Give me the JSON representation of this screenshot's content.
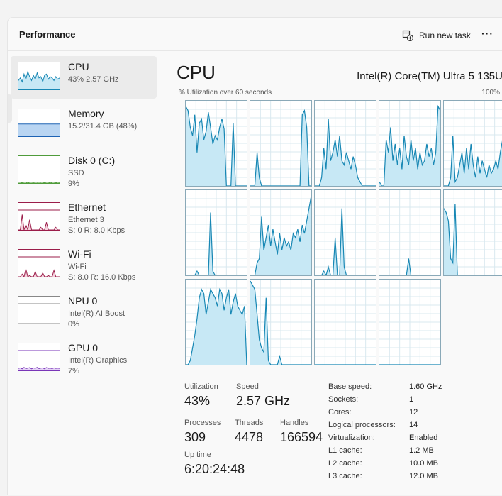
{
  "header": {
    "title": "Performance",
    "run_task_label": "Run new task",
    "more_label": "···"
  },
  "sidebar": {
    "items": [
      {
        "name": "CPU",
        "line1": "43% 2.57 GHz",
        "line2": "",
        "line3": "",
        "color": "#1787b4",
        "fill": "#c7e8f5",
        "selected": true
      },
      {
        "name": "Memory",
        "line1": "15.2/31.4 GB (48%)",
        "line2": "",
        "line3": "",
        "color": "#1e63b4",
        "fill": "#b9d5f2"
      },
      {
        "name": "Disk 0 (C:)",
        "line1": "SSD",
        "line2": "9%",
        "line3": "",
        "color": "#4f9b3a",
        "fill": "#d8efcd"
      },
      {
        "name": "Ethernet",
        "line1": "Ethernet 3",
        "line2": "S: 0 R: 8.0 Kbps",
        "line3": "",
        "color": "#9b1d4a",
        "fill": "#f4d2dd"
      },
      {
        "name": "Wi-Fi",
        "line1": "Wi-Fi",
        "line2": "S: 8.0 R: 16.0 Kbps",
        "line3": "",
        "color": "#9b1d4a",
        "fill": "#f4d2dd"
      },
      {
        "name": "NPU 0",
        "line1": "Intel(R) AI Boost",
        "line2": "0%",
        "line3": "",
        "color": "#888888",
        "fill": "#ffffff"
      },
      {
        "name": "GPU 0",
        "line1": "Intel(R) Graphics",
        "line2": "7%",
        "line3": "",
        "color": "#7a36b8",
        "fill": "#e4d3f5"
      }
    ]
  },
  "main": {
    "title": "CPU",
    "model": "Intel(R) Core(TM) Ultra 5 135U",
    "util_label": "% Utilization over 60 seconds",
    "util_max": "100%",
    "line_color": "#1787b4",
    "fill_color": "#c7e8f5",
    "grid_color": "#d9e8ef"
  },
  "chart_data": {
    "type": "area",
    "ylim": [
      0,
      100
    ],
    "series": [
      {
        "values": [
          95,
          90,
          70,
          60,
          85,
          40,
          75,
          80,
          55,
          65,
          88,
          70,
          50,
          60,
          55,
          70,
          80,
          68,
          0,
          0,
          0,
          75,
          0,
          0,
          0,
          0,
          0,
          0
        ]
      },
      {
        "values": [
          0,
          0,
          0,
          40,
          10,
          0,
          0,
          0,
          0,
          0,
          0,
          0,
          0,
          0,
          0,
          0,
          0,
          0,
          0,
          0,
          0,
          0,
          0,
          85,
          90,
          70,
          0,
          0
        ]
      },
      {
        "values": [
          0,
          0,
          0,
          10,
          45,
          20,
          80,
          30,
          40,
          55,
          35,
          60,
          30,
          25,
          40,
          30,
          20,
          35,
          25,
          10,
          5,
          0,
          0,
          0,
          0,
          0,
          0,
          0
        ]
      },
      {
        "values": [
          5,
          0,
          0,
          55,
          40,
          70,
          30,
          50,
          25,
          45,
          20,
          60,
          35,
          25,
          55,
          30,
          45,
          20,
          40,
          25,
          30,
          50,
          35,
          45,
          25,
          40,
          95,
          90
        ]
      },
      {
        "values": [
          0,
          0,
          0,
          10,
          60,
          5,
          10,
          25,
          40,
          15,
          45,
          20,
          50,
          25,
          10,
          35,
          15,
          30,
          20,
          10,
          25,
          15,
          20,
          30,
          20,
          40,
          55,
          60
        ]
      },
      {
        "values": [
          0,
          0,
          0,
          0,
          0,
          5,
          0,
          0,
          0,
          0,
          0,
          75,
          5,
          0,
          0,
          0,
          0,
          0,
          0,
          0,
          0,
          0,
          0,
          0,
          0,
          0,
          0,
          0
        ]
      },
      {
        "values": [
          0,
          0,
          0,
          15,
          20,
          70,
          30,
          45,
          60,
          35,
          55,
          40,
          25,
          50,
          30,
          45,
          35,
          40,
          30,
          50,
          45,
          55,
          40,
          60,
          50,
          65,
          80,
          95
        ]
      },
      {
        "values": [
          0,
          0,
          0,
          0,
          5,
          0,
          10,
          0,
          0,
          45,
          0,
          0,
          80,
          10,
          0,
          0,
          0,
          0,
          0,
          0,
          0,
          0,
          0,
          0,
          0,
          0,
          0,
          0
        ]
      },
      {
        "values": [
          0,
          0,
          0,
          0,
          0,
          0,
          0,
          0,
          0,
          0,
          0,
          0,
          0,
          20,
          0,
          0,
          0,
          0,
          0,
          0,
          0,
          0,
          0,
          0,
          0,
          0,
          0,
          0
        ]
      },
      {
        "values": [
          80,
          75,
          65,
          20,
          15,
          85,
          0,
          0,
          0,
          0,
          0,
          0,
          0,
          0,
          0,
          0,
          0,
          0,
          0,
          0,
          0,
          0,
          0,
          0,
          0,
          0,
          0,
          0
        ]
      },
      {
        "values": [
          0,
          0,
          5,
          20,
          35,
          55,
          80,
          90,
          85,
          60,
          75,
          90,
          85,
          80,
          70,
          90,
          85,
          65,
          80,
          90,
          60,
          75,
          85,
          70,
          65,
          60,
          70,
          0
        ]
      },
      {
        "values": [
          100,
          95,
          90,
          60,
          30,
          20,
          15,
          80,
          5,
          0,
          0,
          0,
          0,
          10,
          0,
          0,
          0,
          0,
          0,
          0,
          0,
          0,
          0,
          0,
          0,
          0,
          0,
          0
        ]
      },
      {
        "values": [
          0,
          0,
          0,
          0,
          0,
          0,
          0,
          0,
          0,
          0,
          0,
          0,
          0,
          0,
          0,
          0,
          0,
          0,
          0,
          0,
          0,
          0,
          0,
          0,
          0,
          0,
          0,
          0
        ]
      },
      {
        "values": [
          0,
          0,
          0,
          0,
          0,
          0,
          0,
          0,
          0,
          0,
          0,
          0,
          0,
          0,
          0,
          0,
          0,
          0,
          0,
          0,
          0,
          0,
          0,
          0,
          0,
          0,
          0,
          0
        ]
      }
    ]
  },
  "stats": {
    "utilization_label": "Utilization",
    "utilization": "43%",
    "speed_label": "Speed",
    "speed": "2.57 GHz",
    "processes_label": "Processes",
    "processes": "309",
    "threads_label": "Threads",
    "threads": "4478",
    "handles_label": "Handles",
    "handles": "166594",
    "uptime_label": "Up time",
    "uptime": "6:20:24:48"
  },
  "specs": [
    {
      "label": "Base speed:",
      "value": "1.60 GHz"
    },
    {
      "label": "Sockets:",
      "value": "1"
    },
    {
      "label": "Cores:",
      "value": "12"
    },
    {
      "label": "Logical processors:",
      "value": "14"
    },
    {
      "label": "Virtualization:",
      "value": "Enabled"
    },
    {
      "label": "L1 cache:",
      "value": "1.2 MB"
    },
    {
      "label": "L2 cache:",
      "value": "10.0 MB"
    },
    {
      "label": "L3 cache:",
      "value": "12.0 MB"
    }
  ]
}
